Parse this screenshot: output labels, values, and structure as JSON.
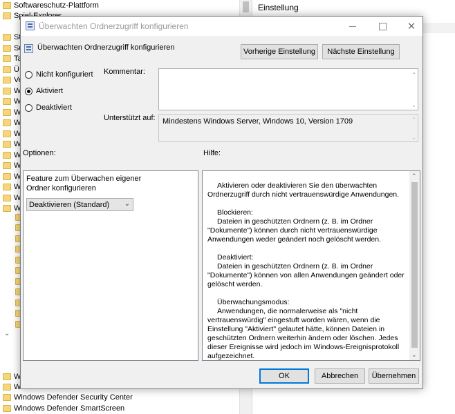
{
  "tree": {
    "items": [
      "Softwareschutz-Plattform",
      "Spiel-Explorer",
      "St",
      "Su",
      "Ta",
      "Ü",
      "Ve",
      "W",
      "W",
      "W",
      "W",
      "W",
      "W",
      "W",
      "W",
      "W",
      "W",
      "W",
      "W"
    ],
    "bottom_items": [
      "W",
      "W",
      "Windows Defender Security Center",
      "Windows Defender SmartScreen"
    ]
  },
  "right_pane": {
    "header": "Einstellung"
  },
  "dialog": {
    "title": "Überwachten Ordnerzugriff konfigurieren",
    "header_title": "Überwachten Ordnerzugriff konfigurieren",
    "prev_button": "Vorherige Einstellung",
    "next_button": "Nächste Einstellung",
    "radio": {
      "not_configured": "Nicht konfiguriert",
      "enabled": "Aktiviert",
      "disabled": "Deaktiviert",
      "selected": "enabled"
    },
    "comment_label": "Kommentar:",
    "supported_label": "Unterstützt auf:",
    "supported_value": "Mindestens Windows Server, Windows 10, Version 1709",
    "options_label": "Optionen:",
    "help_label": "Hilfe:",
    "option_feature_label": "Feature zum Überwachen eigener Ordner konfigurieren",
    "option_select_value": "Deaktivieren (Standard)",
    "help": {
      "p1": "Aktivieren oder deaktivieren Sie den überwachten Ordnerzugriff durch nicht vertrauenswürdige Anwendungen.",
      "p2_title": "Blockieren:",
      "p2_body": "Dateien in geschützten Ordnern (z. B. im Ordner \"Dokumente\") können durch nicht vertrauenswürdige Anwendungen weder geändert noch gelöscht werden.",
      "p3_title": "Deaktiviert:",
      "p3_body": "Dateien in geschützten Ordnern (z. B. im Ordner \"Dokumente\") können von allen Anwendungen geändert oder gelöscht werden.",
      "p4_title": "Überwachungsmodus:",
      "p4_body": "Anwendungen, die normalerweise als \"nicht vertrauenswürdig\" eingestuft worden wären, wenn die Einstellung \"Aktiviert\" gelautet hätte, können Dateien in geschützten Ordnern weiterhin ändern oder löschen. Jedes dieser Ereignisse wird jedoch im Windows-Ereignisprotokoll aufgezeichnet."
    },
    "ok_button": "OK",
    "cancel_button": "Abbrechen",
    "apply_button": "Übernehmen"
  },
  "colors": {
    "accent": "#0078d7",
    "folder": "#f5d679",
    "dialog_bg": "#f0f0f0"
  }
}
